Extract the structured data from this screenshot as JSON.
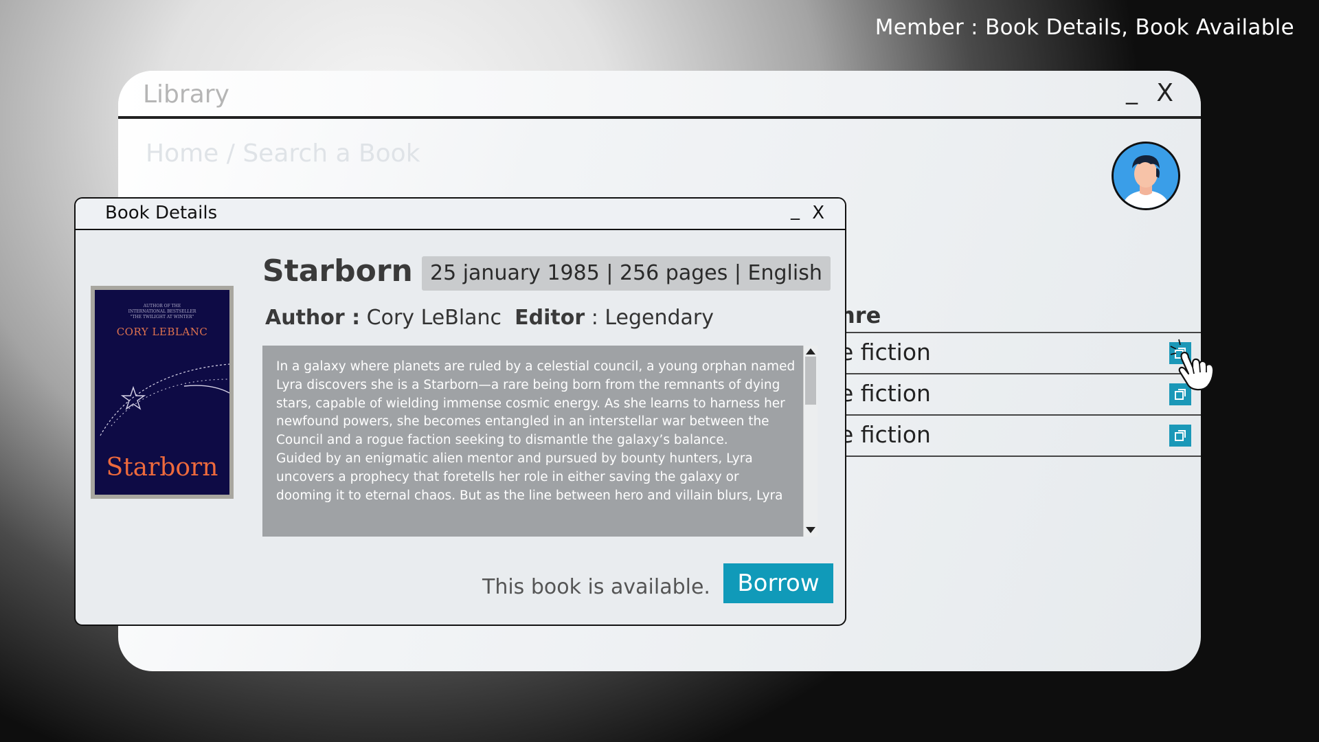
{
  "caption": "Member : Book Details, Book Available",
  "library_window": {
    "title": "Library",
    "minimize_label": "_",
    "close_label": "X",
    "breadcrumb": "Home / Search a Book",
    "genre_header": "nre",
    "results": [
      {
        "genre": "e fiction"
      },
      {
        "genre": "e fiction"
      },
      {
        "genre": "e fiction"
      }
    ]
  },
  "dialog": {
    "title": "Book Details",
    "minimize_label": "_",
    "close_label": "X",
    "cover": {
      "top_text": "AUTHOR OF THE\nINTERNATIONAL BESTSELLER\n\"THE TWILIGHT AT WINTER\"",
      "author": "CORY LEBLANC",
      "title": "Starborn"
    },
    "book_title": "Starborn",
    "meta": "25 january 1985 | 256 pages | English",
    "author_label": "Author :",
    "author": "Cory LeBlanc",
    "editor_label": "Editor",
    "editor": ": Legendary",
    "synopsis": "In a galaxy where planets are ruled by a celestial council, a young orphan named Lyra discovers she is a Starborn—a rare being born from the remnants of dying stars, capable of wielding immense cosmic energy. As she learns to harness her newfound powers, she becomes entangled in an interstellar war between the Council and a rogue faction seeking to dismantle the galaxy’s balance.\nGuided by an enigmatic alien mentor and pursued by bounty hunters, Lyra uncovers a prophecy that foretells her role in either saving the galaxy or dooming it to eternal chaos. But as the line between hero and villain blurs, Lyra",
    "availability": "This book is available.",
    "borrow_label": "Borrow"
  },
  "colors": {
    "accent": "#109ab9",
    "cover_bg": "#0e0b45",
    "cover_title": "#ee6a3c"
  },
  "icons": [
    "user-avatar",
    "open-in-window-icon",
    "hand-pointer-cursor",
    "star-icon"
  ]
}
